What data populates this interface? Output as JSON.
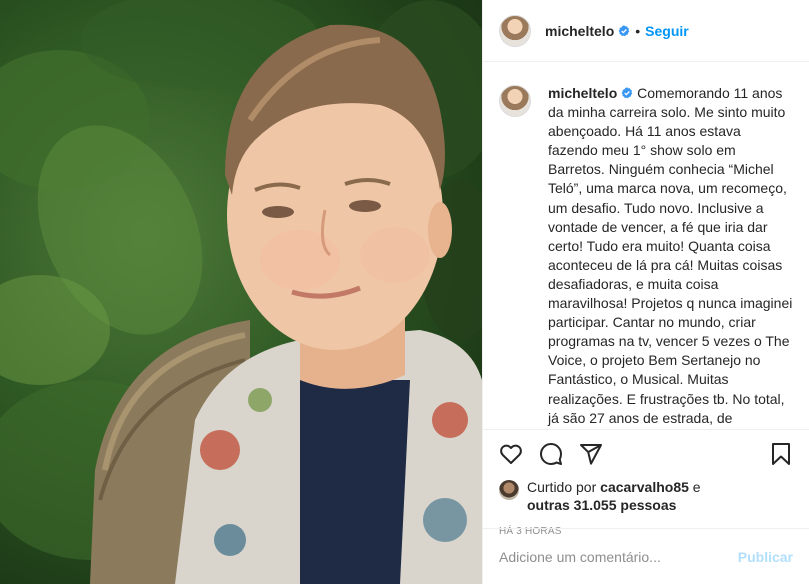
{
  "post": {
    "username": "micheltelo",
    "dot": "•",
    "follow_label": "Seguir",
    "caption": "Comemorando 11 anos da minha carreira solo. Me sinto muito abençoado. Há 11 anos estava fazendo meu 1° show solo em Barretos. Ninguém conhecia “Michel Teló”, uma marca nova, um recomeço, um desafio. Tudo novo. Inclusive a vontade de vencer, a fé que iria dar certo! Tudo era muito! Quanta coisa aconteceu de lá pra cá! Muitas coisas desafiadoras, e muita coisa maravilhosa! Projetos q nunca imaginei participar. Cantar no mundo, criar programas na tv, vencer 5 vezes o The Voice, o projeto Bem Sertanejo no Fantástico, o Musical. Muitas realizações. E frustrações tb. No total, já são 27 anos de estrada, de carreira... e o q me motivou, sempre, o prazer",
    "liked_by_prefix": "Curtido por ",
    "liked_by_user": "cacarvalho85",
    "liked_by_joiner": " e",
    "others_count": "outras 31.055 pessoas",
    "time_ago": "HÁ 3 HORAS",
    "comment_placeholder": "Adicione um comentário...",
    "publish_label": "Publicar"
  },
  "icons": {
    "like": "heart-icon",
    "comment": "comment-icon",
    "share": "share-icon",
    "save": "bookmark-icon",
    "verified": "verified-badge-icon"
  },
  "colors": {
    "accent": "#0095f6",
    "publish_disabled": "#b2dffc",
    "verified": "#3897f0",
    "muted": "#8e8e8e"
  }
}
